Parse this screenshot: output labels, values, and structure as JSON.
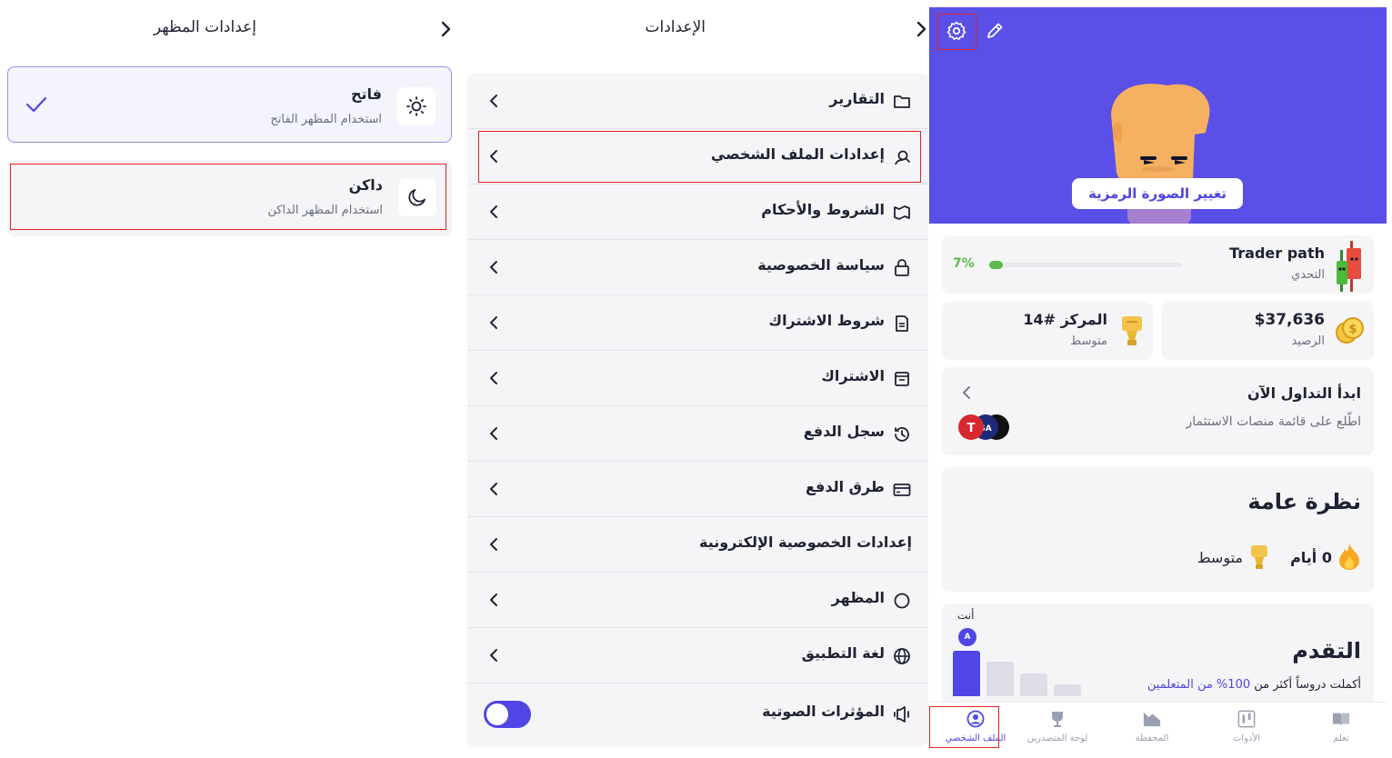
{
  "appearance": {
    "title": "إعدادات المظهر",
    "options": [
      {
        "label": "فاتح",
        "description": "استخدام المظهر الفاتح",
        "icon": "sun-icon",
        "selected": true
      },
      {
        "label": "داكن",
        "description": "استخدام المظهر الداكن",
        "icon": "moon-icon",
        "selected": false
      }
    ]
  },
  "settings": {
    "title": "الإعدادات",
    "items": [
      {
        "label": "التقارير",
        "icon": "folder-icon"
      },
      {
        "label": "إعدادات الملف الشخصي",
        "icon": "user-settings-icon"
      },
      {
        "label": "الشروط والأحكام",
        "icon": "map-icon"
      },
      {
        "label": "سياسة الخصوصية",
        "icon": "lock-icon"
      },
      {
        "label": "شروط الاشتراك",
        "icon": "document-icon"
      },
      {
        "label": "الاشتراك",
        "icon": "receipt-icon"
      },
      {
        "label": "سجل الدفع",
        "icon": "history-icon"
      },
      {
        "label": "طرق الدفع",
        "icon": "credit-card-icon"
      },
      {
        "label": "إعدادات الخصوصية الإلكترونية",
        "icon": "none"
      },
      {
        "label": "المظهر",
        "icon": "theme-icon"
      },
      {
        "label": "لغة التطبيق",
        "icon": "globe-icon"
      },
      {
        "label": "المؤثرات الصوتية",
        "icon": "sound-icon",
        "toggle_on": true
      }
    ]
  },
  "profile": {
    "change_avatar": "تغيير الصورة الرمزية",
    "challenge": {
      "title": "Trader path",
      "subtitle": "التحدي",
      "progress_text": "7%",
      "progress": 0.07
    },
    "balance": {
      "value": "$37,636",
      "label": "الرصيد"
    },
    "rank": {
      "value": "المركز #14",
      "label": "متوسط"
    },
    "trade": {
      "title": "ابدأ التداول الآن",
      "subtitle": "اطّلع على قائمة منصات الاستثمار"
    },
    "overview": {
      "title": "نظرة عامة",
      "streak": "0 أيام",
      "level": "متوسط"
    },
    "progress_section": {
      "title": "التقدم",
      "subtitle_prefix": "أكملت دروساً أكثر من ",
      "subtitle_highlight": "100% من المتعلمين",
      "you_label": "أنت",
      "avatar_letter": "A",
      "bars": [
        1.0,
        0.75,
        0.5,
        0.25
      ]
    },
    "tabs": [
      {
        "label": "الملف الشخصي",
        "icon": "profile-icon",
        "active": true
      },
      {
        "label": "لوحة المتصدرين",
        "icon": "trophy-icon",
        "active": false
      },
      {
        "label": "المحفظة",
        "icon": "portfolio-icon",
        "active": false
      },
      {
        "label": "الأدوات",
        "icon": "tools-icon",
        "active": false
      },
      {
        "label": "تعلم",
        "icon": "book-icon",
        "active": false
      }
    ]
  },
  "colors": {
    "accent": "#4f46e5",
    "hero": "#5a4fe6",
    "progress": "#5dbb4b",
    "highlight": "#e52222"
  }
}
